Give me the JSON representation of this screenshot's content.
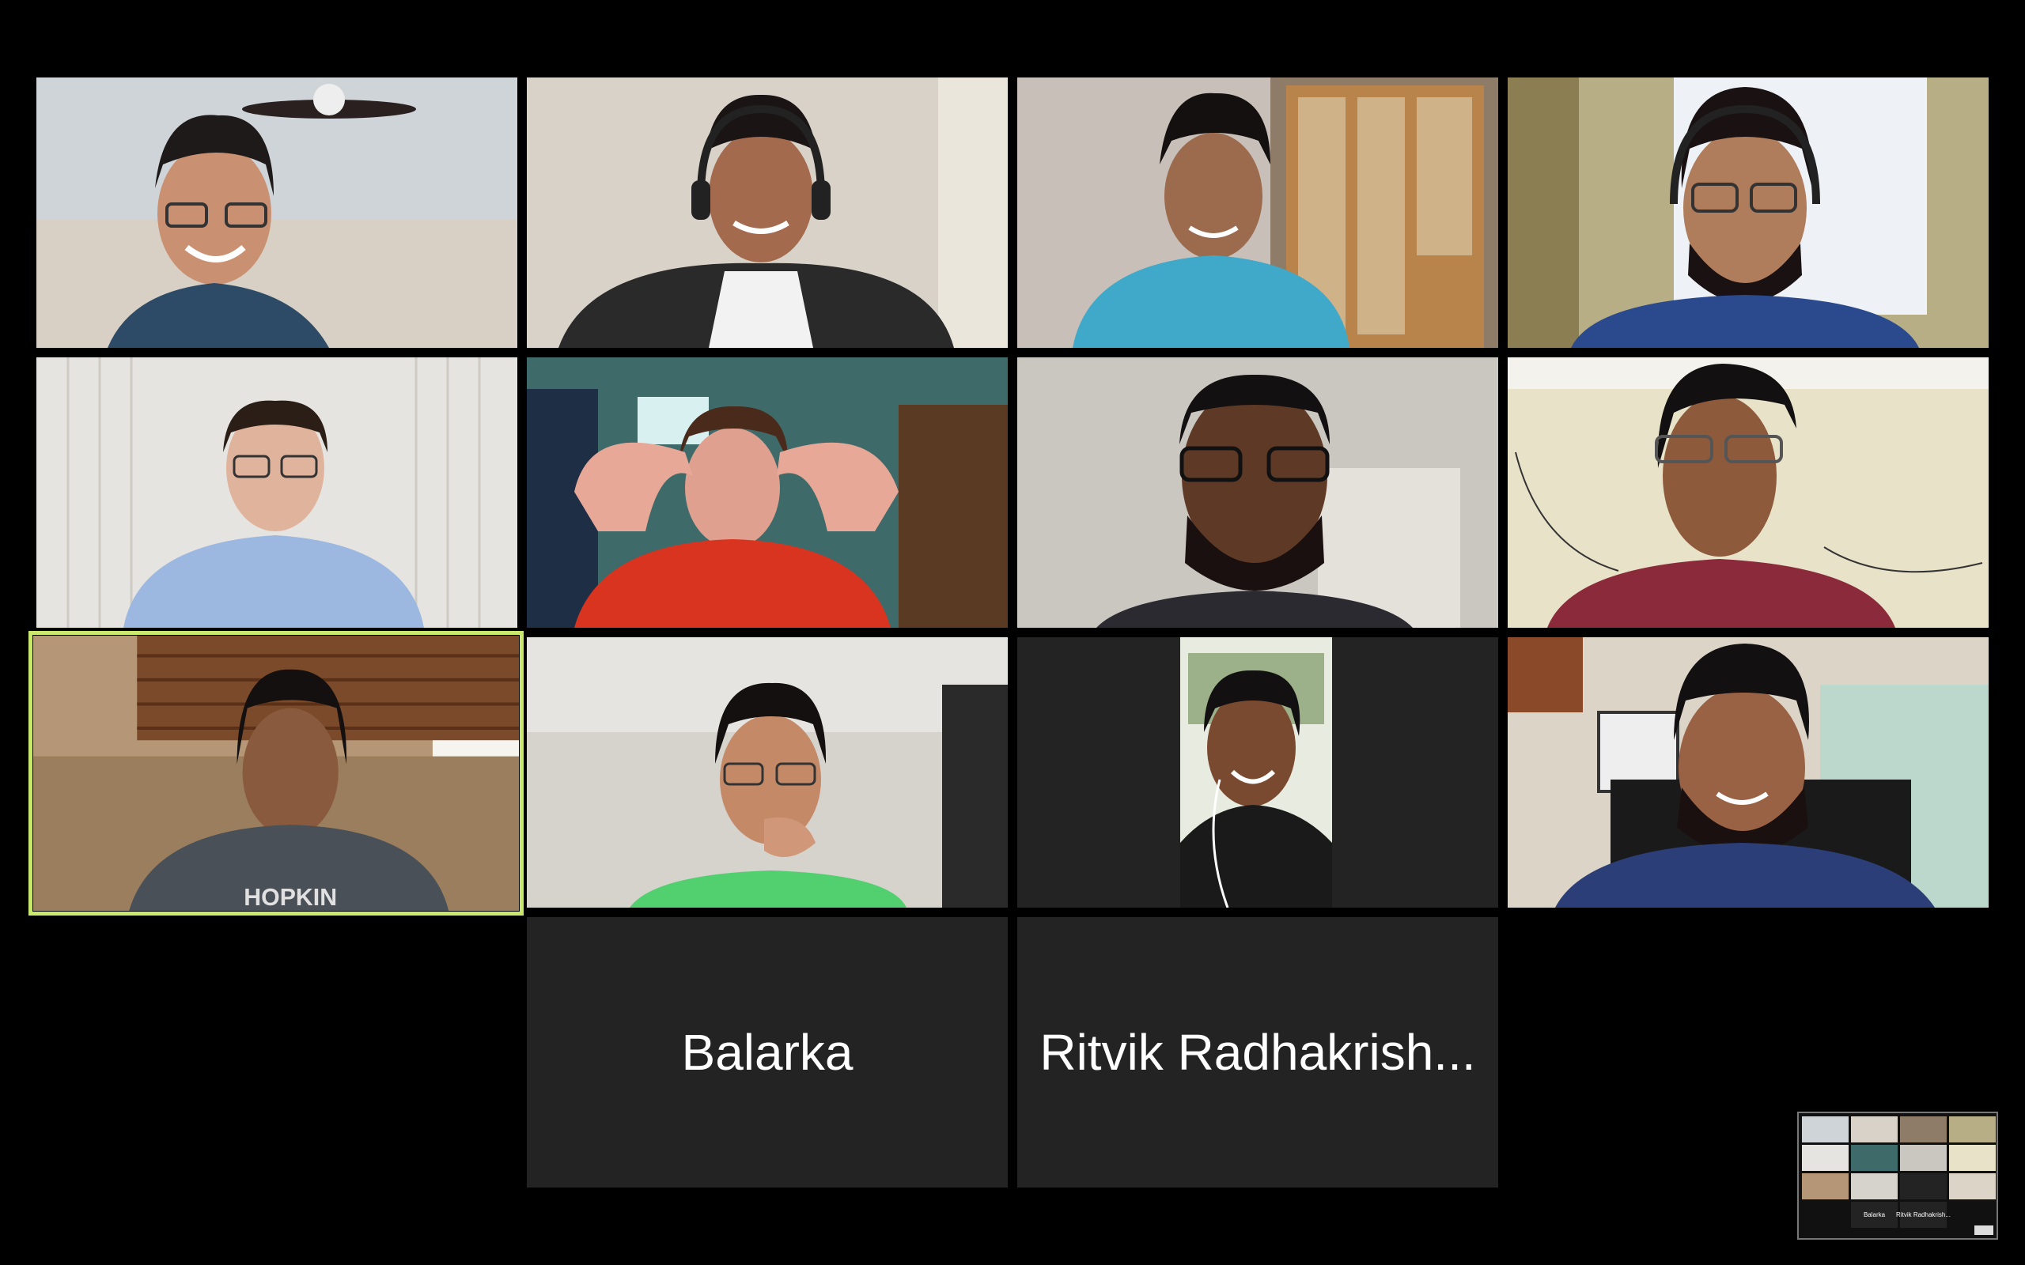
{
  "participants": [
    {
      "id": 1,
      "bg": "#cfd4d8",
      "skin": "#c99072",
      "shirt": "#2d4a66",
      "hair": "#1e1a1a"
    },
    {
      "id": 2,
      "bg": "#d9d2c8",
      "skin": "#a46a4e",
      "shirt": "#2a2a2a",
      "hair": "#1a1414"
    },
    {
      "id": 3,
      "bg": "#8e7c68",
      "skin": "#9c6a4c",
      "shirt": "#40a8c8",
      "hair": "#141010"
    },
    {
      "id": 4,
      "bg": "#b8ae86",
      "skin": "#b07d5c",
      "shirt": "#2b4a8e",
      "hair": "#1a1212"
    },
    {
      "id": 5,
      "bg": "#e6e4e0",
      "skin": "#e0b49c",
      "shirt": "#9cb8e0",
      "hair": "#2a1e16"
    },
    {
      "id": 6,
      "bg": "#3f6a6a",
      "skin": "#e0a090",
      "shirt": "#d83420",
      "hair": "#4a2a1a"
    },
    {
      "id": 7,
      "bg": "#cac6c0",
      "skin": "#5e3a26",
      "shirt": "#2a2a30",
      "hair": "#121010"
    },
    {
      "id": 8,
      "bg": "#e8e2c8",
      "skin": "#8e5a3c",
      "shirt": "#8a2a3a",
      "hair": "#121010"
    },
    {
      "id": 9,
      "bg": "#b59676",
      "skin": "#8a5a3e",
      "shirt": "#4a5058",
      "hair": "#141010"
    },
    {
      "id": 10,
      "bg": "#d6d2cc",
      "skin": "#c48a68",
      "shirt": "#52d070",
      "hair": "#141010"
    },
    {
      "id": 11,
      "bg": "#e8ece0",
      "skin": "#7a4a30",
      "shirt": "#1a1a1a",
      "hair": "#121010"
    },
    {
      "id": 12,
      "bg": "#dcd4c6",
      "skin": "#9a6244",
      "shirt": "#2c3e78",
      "hair": "#121010"
    }
  ],
  "name_tiles": [
    {
      "name": "Balarka"
    },
    {
      "name": "Ritvik Radhakrish..."
    }
  ],
  "mini_view": {
    "name_a": "Balarka",
    "name_b": "Ritvik Radhakrish..."
  }
}
